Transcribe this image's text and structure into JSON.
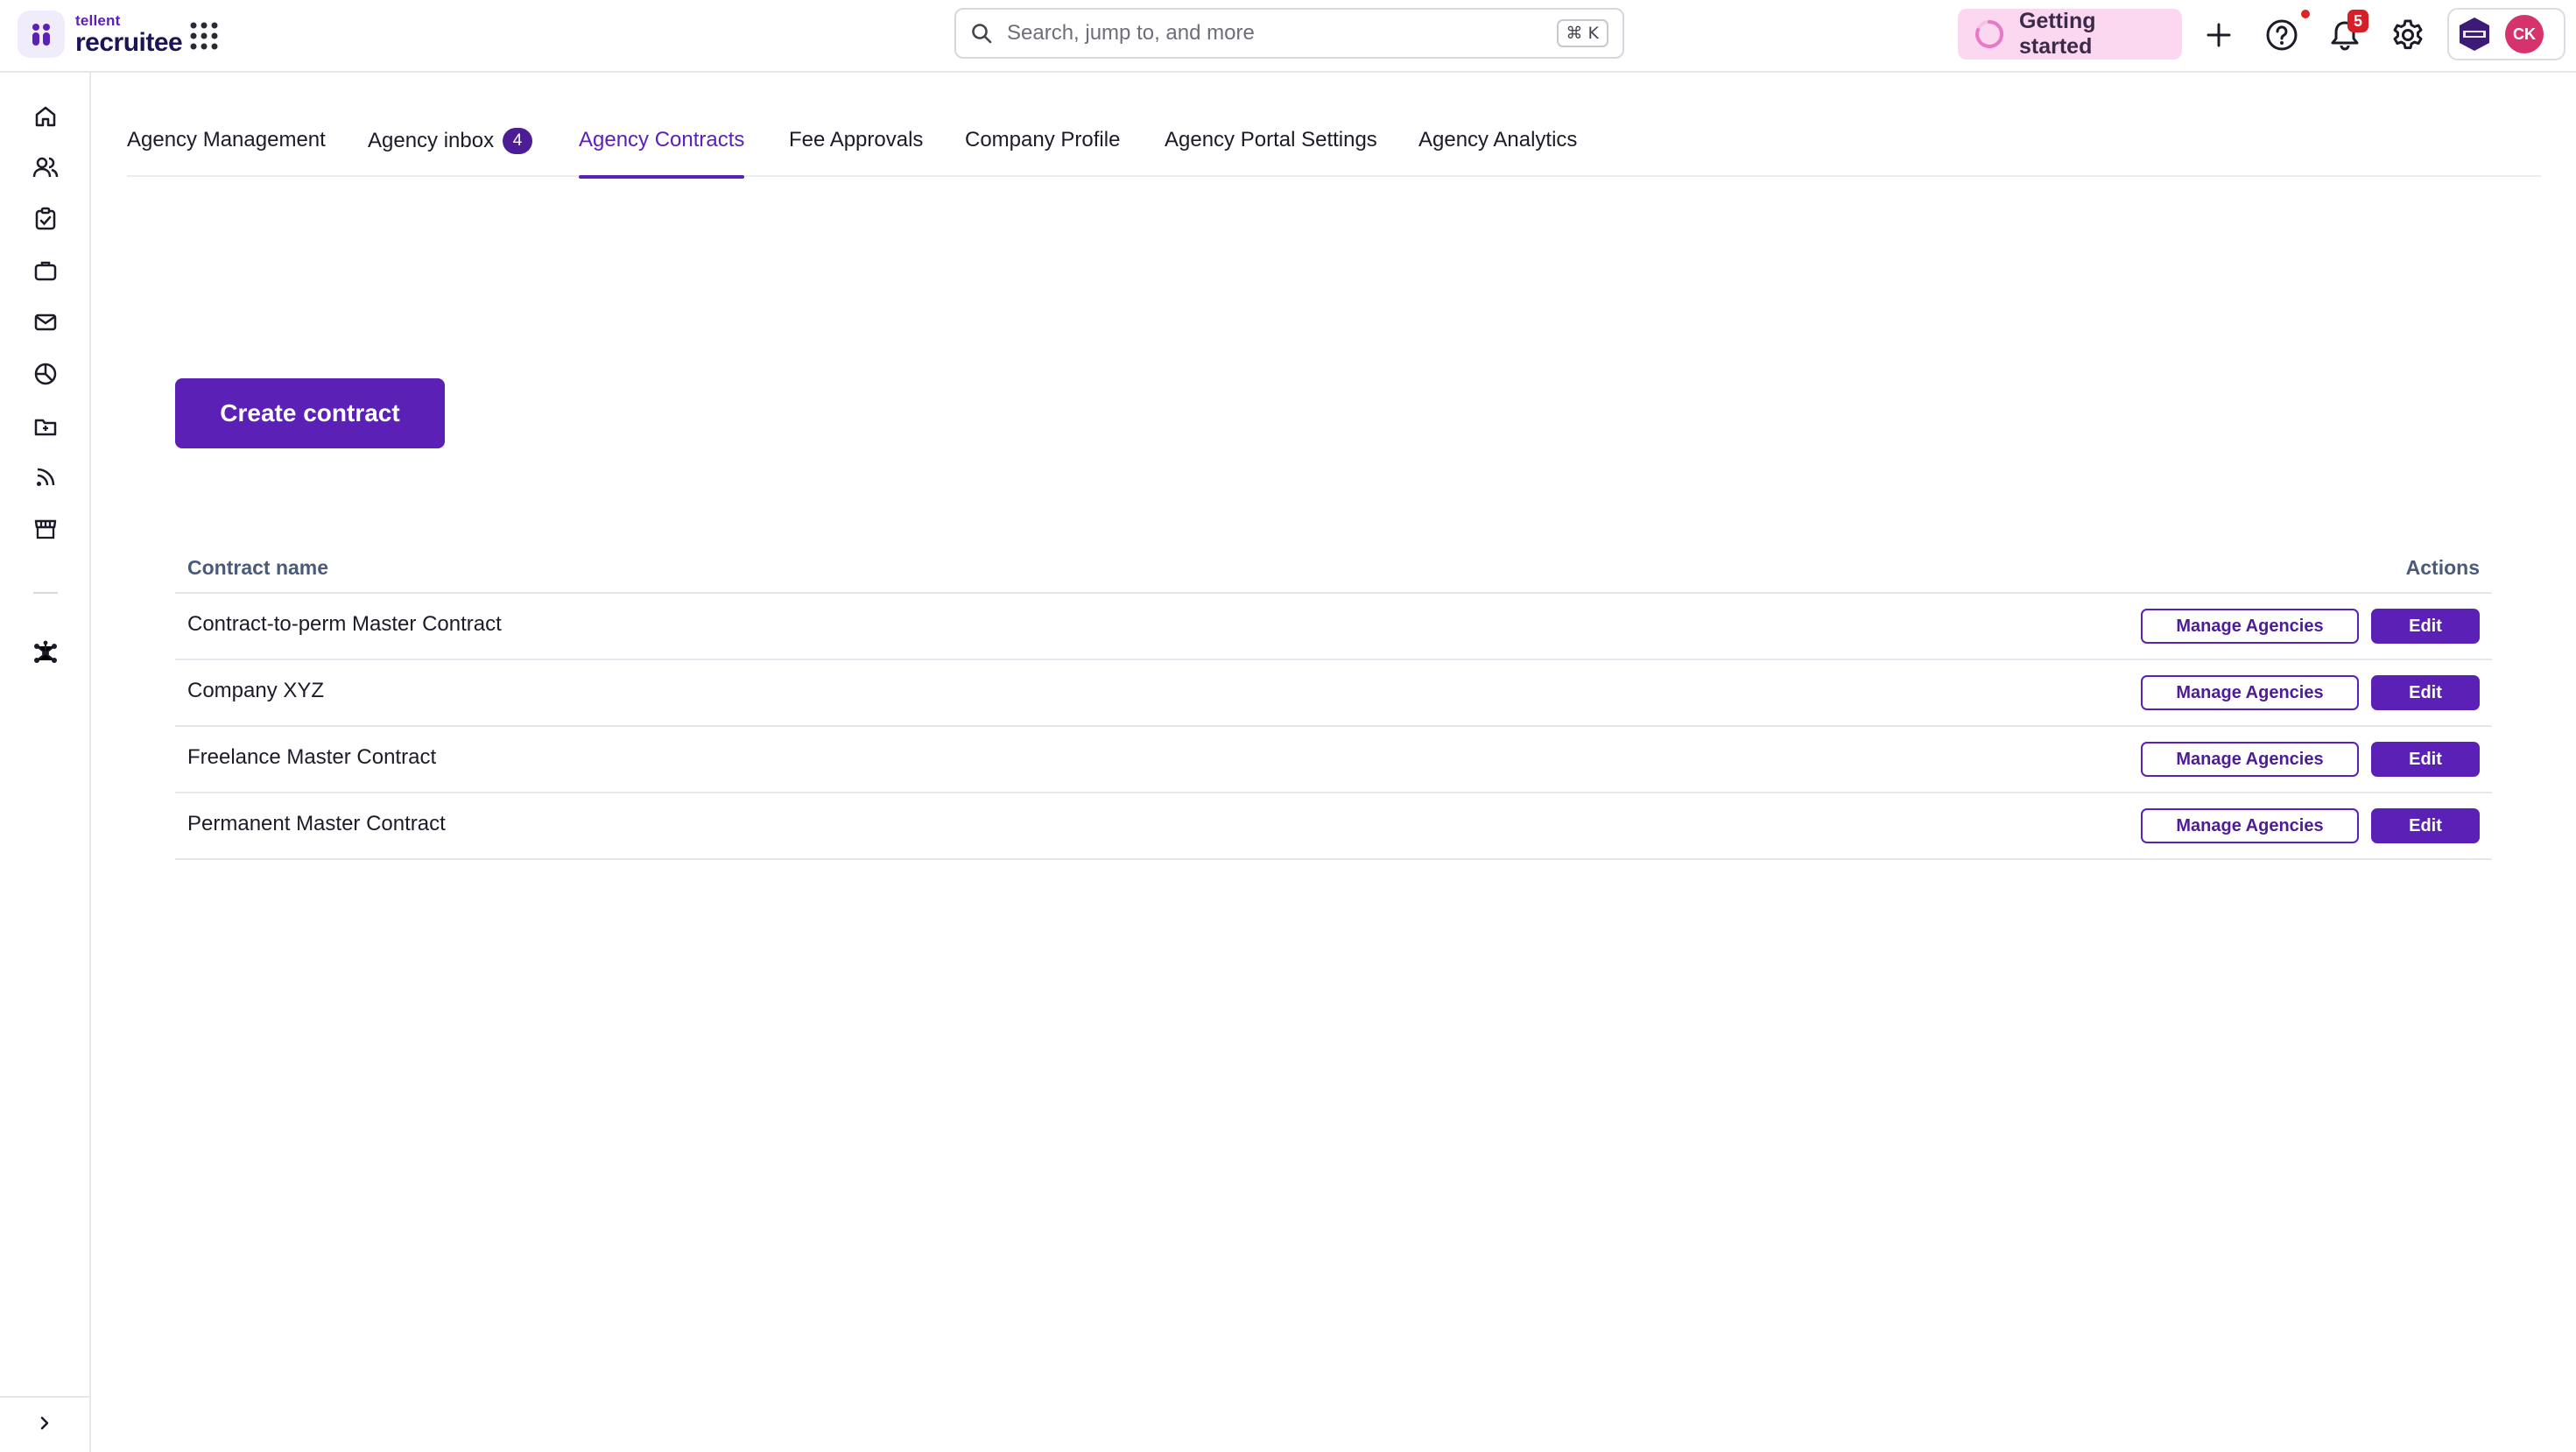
{
  "brand": {
    "name_small": "tellent",
    "name_big": "recruitee",
    "accent_color": "#5b21b6"
  },
  "header": {
    "search_placeholder": "Search, jump to, and more",
    "search_shortcut": "⌘ K",
    "getting_started_label": "Getting started",
    "notification_count": "5",
    "avatar_initials": "CK",
    "icons": [
      "apps-grid-icon",
      "search-icon",
      "plus-icon",
      "help-icon",
      "bell-icon",
      "gear-icon"
    ]
  },
  "sidebar": {
    "items": [
      {
        "icon": "home-icon"
      },
      {
        "icon": "candidates-icon"
      },
      {
        "icon": "tasks-icon"
      },
      {
        "icon": "jobs-icon"
      },
      {
        "icon": "mailbox-icon"
      },
      {
        "icon": "reports-icon"
      },
      {
        "icon": "talent-pools-icon"
      },
      {
        "icon": "feed-icon"
      },
      {
        "icon": "marketplace-icon"
      },
      {
        "icon": "integrations-icon"
      }
    ],
    "collapse_icon": "chevron-right-icon"
  },
  "tabs": [
    {
      "label": "Agency Management",
      "active": false
    },
    {
      "label": "Agency inbox",
      "badge": "4",
      "active": false
    },
    {
      "label": "Agency Contracts",
      "active": true
    },
    {
      "label": "Fee Approvals",
      "active": false
    },
    {
      "label": "Company Profile",
      "active": false
    },
    {
      "label": "Agency Portal Settings",
      "active": false
    },
    {
      "label": "Agency Analytics",
      "active": false
    }
  ],
  "main": {
    "create_button_label": "Create contract",
    "table": {
      "columns": [
        "Contract name",
        "Actions"
      ],
      "rows": [
        {
          "name": "Contract-to-perm Master Contract",
          "manage_label": "Manage Agencies",
          "edit_label": "Edit"
        },
        {
          "name": "Company XYZ",
          "manage_label": "Manage Agencies",
          "edit_label": "Edit"
        },
        {
          "name": "Freelance Master Contract",
          "manage_label": "Manage Agencies",
          "edit_label": "Edit"
        },
        {
          "name": "Permanent Master Contract",
          "manage_label": "Manage Agencies",
          "edit_label": "Edit"
        }
      ]
    }
  }
}
